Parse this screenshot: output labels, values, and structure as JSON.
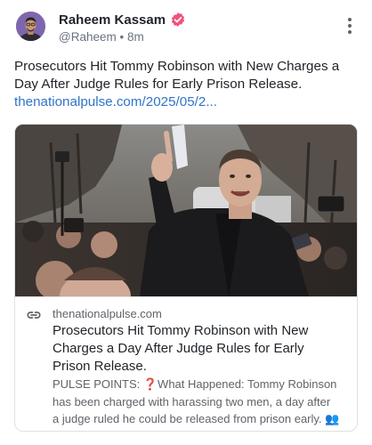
{
  "author": {
    "name": "Raheem Kassam",
    "handle": "@Raheem",
    "separator": "•",
    "time": "8m"
  },
  "post": {
    "text_lines": [
      "Prosecutors Hit Tommy Robinson with New Charges a",
      "Day After Judge Rules for Early Prison Release."
    ],
    "link": "thenationalpulse.com/2025/05/2..."
  },
  "card": {
    "domain": "thenationalpulse.com",
    "title_lines": [
      "Prosecutors Hit Tommy Robinson with New",
      "Charges a Day After Judge Rules for Early",
      "Prison Release."
    ],
    "description_lines": [
      "PULSE POINTS: ❓What Happened: Tommy Robinson",
      "has been charged with harassing two men, a day after",
      "a judge ruled he could be released from prison early. 👥"
    ]
  },
  "colors": {
    "verified_badge": "#f0537b",
    "link": "#2f74c9",
    "avatar_bg": "#7d66ad"
  },
  "icons": {
    "verified": "verified-badge-icon",
    "more": "more-vertical-icon",
    "link": "link-icon"
  }
}
